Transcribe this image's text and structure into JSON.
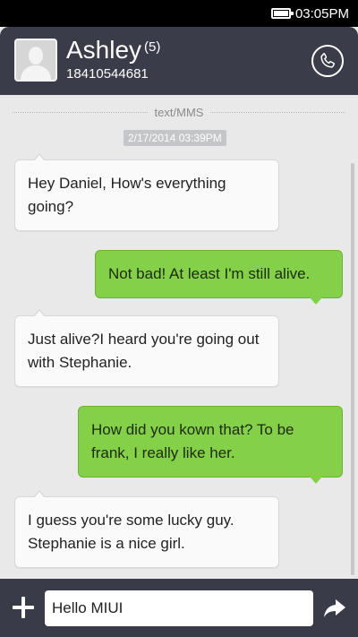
{
  "status_bar": {
    "time": "03:05PM",
    "battery_icon": "battery-full-icon"
  },
  "header": {
    "contact_name": "Ashley",
    "message_count": "(5)",
    "phone_number": "18410544681",
    "avatar_icon": "default-avatar-icon",
    "call_icon": "phone-icon"
  },
  "thread": {
    "type_label": "text/MMS",
    "timestamp": "2/17/2014 03:39PM",
    "messages": [
      {
        "direction": "incoming",
        "text": "Hey Daniel, How's everything going?"
      },
      {
        "direction": "outgoing",
        "text": "Not bad! At least I'm still alive."
      },
      {
        "direction": "incoming",
        "text": "Just  alive?I heard you're going out with Stephanie."
      },
      {
        "direction": "outgoing",
        "text": "How did you kown that? To be frank, I really like her."
      },
      {
        "direction": "incoming",
        "text": "I guess you're some lucky guy. Stephanie is a nice girl."
      }
    ]
  },
  "compose": {
    "input_value": "Hello MIUI",
    "add_icon": "plus-icon",
    "send_icon": "send-arrow-icon"
  },
  "colors": {
    "header_bg": "#3a3d49",
    "thread_bg": "#e9e9ea",
    "outgoing_bubble": "#84d048",
    "incoming_bubble": "#fafafa"
  }
}
